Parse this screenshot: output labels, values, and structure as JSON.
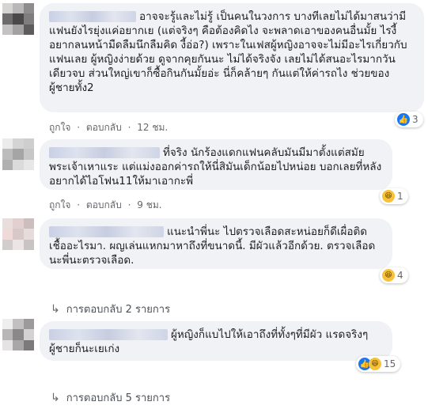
{
  "actions": {
    "like": "ถูกใจ",
    "dot": "·",
    "reply": "ตอบกลับ"
  },
  "comments": [
    {
      "text": "อาจจะรู้และไม่รู้ เป็นคนในวงการ บางทีเลยไม่ได้มาสนว่ามีแฟนยังไรยุ่งแค่อยากเย (แต่จริงๆ คือต้องคิดไง จะพลาดเอาของคนอื่นมั้ย ไรงี้ อยากลนหน้ามืดลืมนึกลืมคิด งี้อ่อ?) เพราะในเฟสผู้หญิงอาจจะไม่มีอะไรเกี่ยวกับแฟนเลย ผู้หญิงง่ายด้วย ดูจากคุยกันนะ ไม่ได้จริงจัง เลยไม่ได้สนอะไรมากวันเดียวจบ ส่วนใหญ่เขาก็ซื้อกินกันมั้ยอ่ะ นี่ก็คล้ายๆ กันแต่ให้ค่ารถไง ช่วยของผู้ชายทั้ง2",
      "time": "12 ชม.",
      "reaction_count": "3"
    },
    {
      "text": "ที่จริง นักร้องแดกแฟนคลับมันมีมาตั้งแต่สมัยพระเจ้าเหาแระ แต่แม่งออกค่ารถให้นี่สิมันเด็กน้อยไปหน่อย บอกเลยที่หลังอยากได้ไอโฟน11ให้มาเอากะพี่",
      "time": "9 ชม.",
      "reaction_count": "1"
    },
    {
      "text": "แนะนำพี่นะ ไปตรวจเลือดสะหน่อยก็ดีเผื่อติดเชื้ออะไรมา. ผญเล่นแหกมาหาถึงที่ขนาดนี้. มีผัวแล้วอีกด้วย. ตรวจเลือดนะพี่นะตรวจเลือด.",
      "reaction_count": "4",
      "replies": "การตอบกลับ 2 รายการ"
    },
    {
      "text": "ผู้หญิงก็แบไปให้เอาถึงที่ทั้งๆที่มีผัว แรดจริงๆ ผู้ชายก็นะเยเก่ง",
      "reaction_count": "15",
      "replies": "การตอบกลับ 5 รายการ"
    }
  ]
}
